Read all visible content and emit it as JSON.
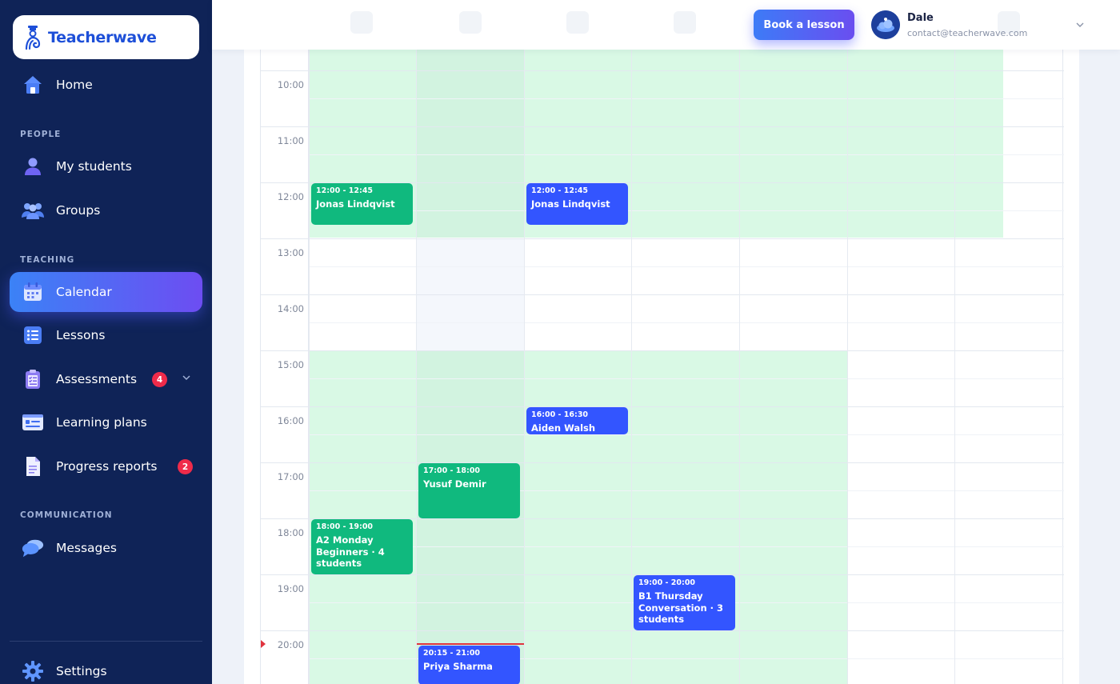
{
  "brand": {
    "name": "Teacherwave"
  },
  "sidebar": {
    "home": "Home",
    "sections": {
      "people": "PEOPLE",
      "teaching": "TEACHING",
      "communication": "COMMUNICATION"
    },
    "my_students": "My students",
    "groups": "Groups",
    "calendar": "Calendar",
    "lessons": "Lessons",
    "assessments": "Assessments",
    "assessments_badge": "4",
    "learning_plans": "Learning plans",
    "progress_reports": "Progress reports",
    "progress_reports_badge": "2",
    "messages": "Messages",
    "settings": "Settings"
  },
  "topbar": {
    "book_button": "Book a lesson",
    "user_name": "Dale",
    "user_email": "contact@teacherwave.com"
  },
  "calendar": {
    "hours": [
      "10:00",
      "11:00",
      "12:00",
      "13:00",
      "14:00",
      "15:00",
      "16:00",
      "17:00",
      "18:00",
      "19:00",
      "20:00"
    ],
    "events": [
      {
        "time": "12:00 - 12:45",
        "title": "Jonas Lindqvist",
        "color": "green"
      },
      {
        "time": "12:00 - 12:45",
        "title": "Jonas Lindqvist",
        "color": "blue"
      },
      {
        "time": "16:00 - 16:30",
        "title": "Aiden Walsh",
        "color": "blue"
      },
      {
        "time": "17:00 - 18:00",
        "title": "Yusuf Demir",
        "color": "green"
      },
      {
        "time": "18:00 - 19:00",
        "title": "A2 Monday Beginners · 4 students",
        "color": "green"
      },
      {
        "time": "19:00 - 20:00",
        "title": "B1 Thursday Conversation · 3 students",
        "color": "blue"
      },
      {
        "time": "20:15 - 21:00",
        "title": "Priya Sharma",
        "color": "blue"
      }
    ]
  },
  "colors": {
    "sidebar_bg": "#0f2357",
    "accent_blue": "#3355ff",
    "accent_green": "#10b97e",
    "availability": "#d9f9e5",
    "badge_red": "#ef2b4a",
    "now_line": "#e0343f"
  }
}
